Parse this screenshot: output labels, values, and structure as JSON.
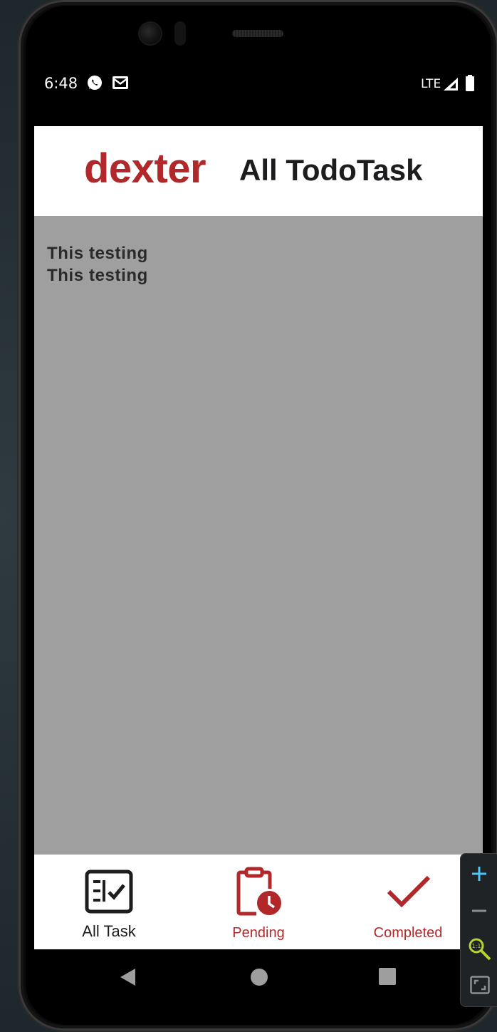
{
  "status_bar": {
    "time": "6:48",
    "icons": [
      "whatsapp-icon",
      "gmail-icon"
    ],
    "network": "LTE",
    "right_icons": [
      "signal-icon",
      "battery-icon"
    ]
  },
  "app_bar": {
    "brand": "dexter",
    "title": "All TodoTask",
    "brand_color": "#b0282a"
  },
  "tasks": [
    {
      "text": "This testing"
    },
    {
      "text": "This testing"
    }
  ],
  "fab": {
    "icon": "plus-icon"
  },
  "bottom_nav": {
    "items": [
      {
        "label": "All Task",
        "icon": "checklist-icon",
        "active": true
      },
      {
        "label": "Pending",
        "icon": "clipboard-clock-icon",
        "active": false
      },
      {
        "label": "Completed",
        "icon": "check-icon",
        "active": false
      }
    ],
    "active_color": "#1d1d1f",
    "inactive_color": "#b0282a"
  },
  "system_nav": [
    "back-icon",
    "home-icon",
    "recents-icon"
  ],
  "emulator_toolbar": [
    "zoom-in-icon",
    "zoom-out-icon",
    "actual-size-icon",
    "fit-screen-icon"
  ],
  "colors": {
    "accent": "#b0282a",
    "content_bg": "#9f9f9f"
  }
}
